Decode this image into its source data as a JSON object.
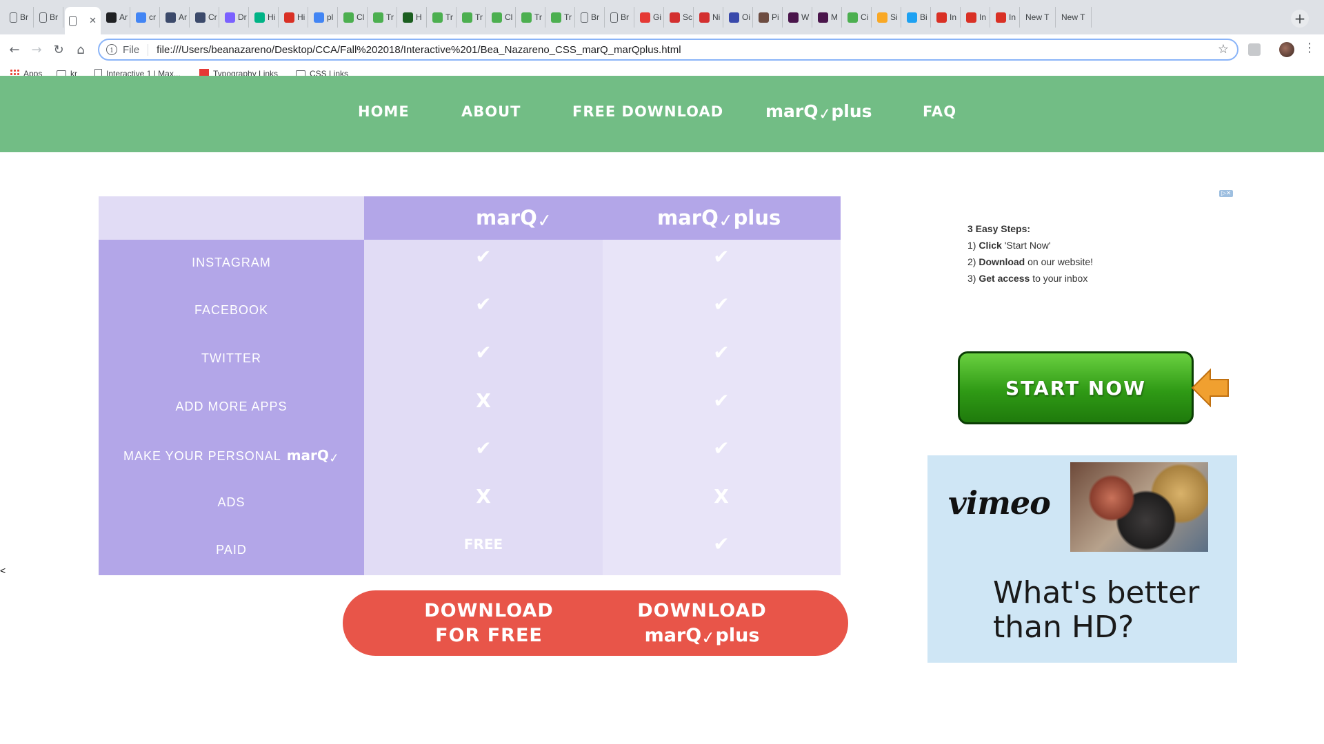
{
  "browser": {
    "tabs": [
      {
        "label": "Br",
        "icon": "doc-icon",
        "color": "#5f6368"
      },
      {
        "label": "Br",
        "icon": "doc-icon",
        "color": "#5f6368"
      },
      {
        "label": "",
        "icon": "doc-icon",
        "color": "#5f6368",
        "active": true
      },
      {
        "label": "Ar",
        "icon": "a-circle-icon",
        "color": "#202124"
      },
      {
        "label": "cr",
        "icon": "google-icon",
        "color": "#4285f4"
      },
      {
        "label": "Ar",
        "icon": "app-icon",
        "color": "#3c4a6b"
      },
      {
        "label": "Cr",
        "icon": "app-icon",
        "color": "#3c4a6b"
      },
      {
        "label": "Dr",
        "icon": "heart-icon",
        "color": "#7b61ff"
      },
      {
        "label": "Hi",
        "icon": "house-icon",
        "color": "#00b386"
      },
      {
        "label": "Hi",
        "icon": "cherry-icon",
        "color": "#d93025"
      },
      {
        "label": "pl",
        "icon": "google-icon",
        "color": "#4285f4"
      },
      {
        "label": "Cl",
        "icon": "w3-icon",
        "color": "#4caf50"
      },
      {
        "label": "Tr",
        "icon": "w3-icon",
        "color": "#4caf50"
      },
      {
        "label": "H",
        "icon": "w3-dark-icon",
        "color": "#1b5e20"
      },
      {
        "label": "Tr",
        "icon": "w3-icon",
        "color": "#4caf50"
      },
      {
        "label": "Tr",
        "icon": "w3-icon",
        "color": "#4caf50"
      },
      {
        "label": "Cl",
        "icon": "w3-icon",
        "color": "#4caf50"
      },
      {
        "label": "Tr",
        "icon": "w3-icon",
        "color": "#4caf50"
      },
      {
        "label": "Tr",
        "icon": "w3-icon",
        "color": "#4caf50"
      },
      {
        "label": "Br",
        "icon": "doc-icon",
        "color": "#5f6368"
      },
      {
        "label": "Br",
        "icon": "doc-icon",
        "color": "#5f6368"
      },
      {
        "label": "Gi",
        "icon": "f-circle-icon",
        "color": "#e53935"
      },
      {
        "label": "Sc",
        "icon": "adobe-icon",
        "color": "#d32f2f"
      },
      {
        "label": "Ni",
        "icon": "adobe-icon",
        "color": "#d32f2f"
      },
      {
        "label": "Oi",
        "icon": "m-icon",
        "color": "#3949ab"
      },
      {
        "label": "Pi",
        "icon": "grid-icon",
        "color": "#6d4c41"
      },
      {
        "label": "W",
        "icon": "slack-icon",
        "color": "#4a154b"
      },
      {
        "label": "M",
        "icon": "hash-icon",
        "color": "#4a154b"
      },
      {
        "label": "Ci",
        "icon": "w3-icon",
        "color": "#4caf50"
      },
      {
        "label": "Si",
        "icon": "star-icon",
        "color": "#f9a825"
      },
      {
        "label": "Bi",
        "icon": "bird-icon",
        "color": "#1da1f2"
      },
      {
        "label": "In",
        "icon": "gmail-icon",
        "color": "#d93025"
      },
      {
        "label": "In",
        "icon": "gmail-icon",
        "color": "#d93025"
      },
      {
        "label": "In",
        "icon": "gmail-icon",
        "color": "#d93025"
      },
      {
        "label": "New T",
        "icon": "",
        "color": ""
      },
      {
        "label": "New T",
        "icon": "",
        "color": ""
      }
    ],
    "url_scheme": "File",
    "url": "file:///Users/beanazareno/Desktop/CCA/Fall%202018/Interactive%201/Bea_Nazareno_CSS_marQ_marQplus.html",
    "bookmarks": [
      {
        "label": "Apps",
        "icon": "apps-grid-icon"
      },
      {
        "label": "kr",
        "icon": "folder-icon"
      },
      {
        "label": "Interactive 1 | Max...",
        "icon": "doc-icon"
      },
      {
        "label": "Typography Links",
        "icon": "red-doc-icon"
      },
      {
        "label": "CSS Links",
        "icon": "folder-icon"
      }
    ]
  },
  "site": {
    "nav": {
      "home": "HOME",
      "about": "ABOUT",
      "free_download": "FREE DOWNLOAD",
      "marq_plus_word": "marQ",
      "marq_plus_suffix": "plus",
      "faq": "FAQ"
    },
    "colors": {
      "nav_bg": "#72bd85",
      "table_purple": "#b3a6e8",
      "table_light": "#e1dcf5",
      "download_red": "#e85549"
    },
    "table": {
      "col1_logo": "marQ",
      "col2_logo_word": "marQ",
      "col2_logo_suffix": "plus",
      "rows": [
        {
          "label": "INSTAGRAM",
          "marq": "check",
          "plus": "check"
        },
        {
          "label": "FACEBOOK",
          "marq": "check",
          "plus": "check"
        },
        {
          "label": "TWITTER",
          "marq": "check",
          "plus": "check"
        },
        {
          "label": "ADD MORE APPS",
          "marq": "X",
          "plus": "check"
        },
        {
          "label": "MAKE YOUR PERSONAL",
          "label_brand": "marQ",
          "marq": "check",
          "plus": "check"
        },
        {
          "label": "ADS",
          "marq": "X",
          "plus": "X"
        },
        {
          "label": "PAID",
          "marq": "FREE",
          "plus": "check"
        }
      ]
    },
    "download": {
      "free_line1": "DOWNLOAD",
      "free_line2": "FOR FREE",
      "plus_line1": "DOWNLOAD",
      "plus_word": "marQ",
      "plus_suffix": "plus"
    },
    "stray_char": "<"
  },
  "ads": {
    "steps_title": "3 Easy Steps:",
    "steps": [
      {
        "num": "1)",
        "bold": "Click",
        "rest": "'Start Now'"
      },
      {
        "num": "2)",
        "bold": "Download",
        "rest": "on our website!"
      },
      {
        "num": "3)",
        "bold": "Get access",
        "rest": "to your inbox"
      }
    ],
    "start_now": "START NOW",
    "vimeo_logo": "vimeo",
    "vimeo_headline_1": "What's better",
    "vimeo_headline_2": "than HD?"
  }
}
